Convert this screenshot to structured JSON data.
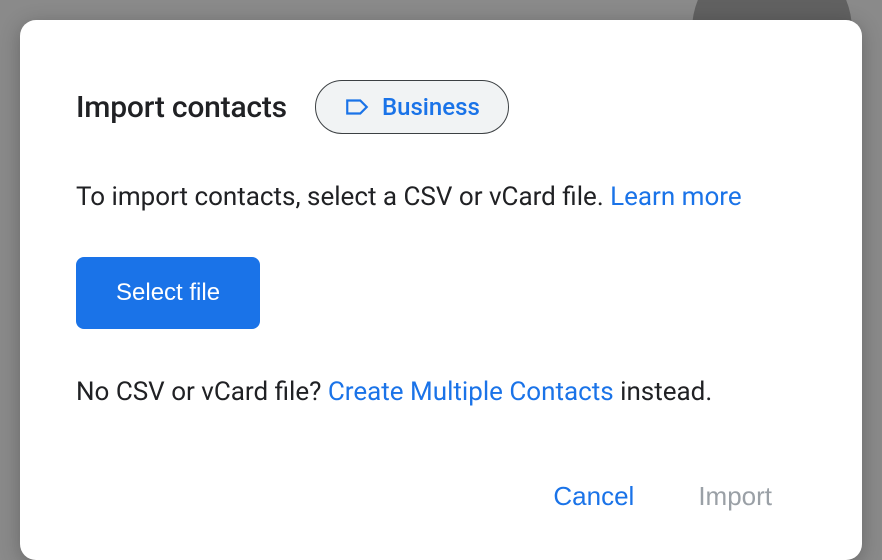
{
  "dialog": {
    "title": "Import contacts",
    "label_chip": {
      "text": "Business"
    },
    "instruction": {
      "prefix": "To import contacts, select a CSV or vCard file. ",
      "link": "Learn more"
    },
    "select_file_label": "Select file",
    "alternative": {
      "prefix": "No CSV or vCard file? ",
      "link": "Create Multiple Contacts",
      "suffix": " instead."
    },
    "actions": {
      "cancel": "Cancel",
      "import": "Import"
    }
  }
}
